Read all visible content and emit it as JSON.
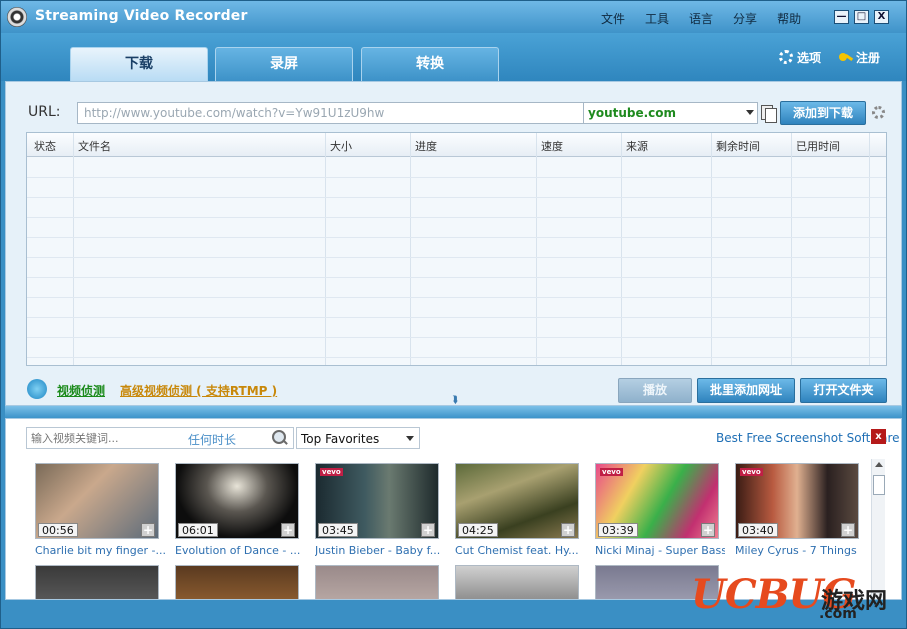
{
  "app": {
    "title": "Streaming Video Recorder"
  },
  "menu": [
    "文件",
    "工具",
    "语言",
    "分享",
    "帮助"
  ],
  "window_buttons": [
    "—",
    "□",
    "X"
  ],
  "tabs": [
    {
      "label": "下载",
      "active": true
    },
    {
      "label": "录屏",
      "active": false
    },
    {
      "label": "转换",
      "active": false
    }
  ],
  "header_actions": {
    "options": "选项",
    "register": "注册"
  },
  "url_bar": {
    "label": "URL:",
    "value": "http://www.youtube.com/watch?v=Yw91U1zU9hw",
    "site": "youtube.com",
    "add_button": "添加到下载"
  },
  "table": {
    "columns": [
      "状态",
      "文件名",
      "大小",
      "进度",
      "速度",
      "来源",
      "剩余时间",
      "已用时间"
    ],
    "rows": []
  },
  "detect": {
    "video_detect": "视频侦测",
    "advanced_detect": "高级视频侦测 ( 支持RTMP )"
  },
  "actions": {
    "play": "播放",
    "batch_add": "批里添加网址",
    "open_folder": "打开文件夹"
  },
  "browser": {
    "search_placeholder": "输入视频关键词...",
    "search_hint": "任何时长",
    "category": "Top Favorites",
    "ad_link": "Best Free Screenshot Software",
    "ad_close": "x"
  },
  "videos": [
    {
      "duration": "00:56",
      "title": "Charlie bit my finger -..."
    },
    {
      "duration": "06:01",
      "title": "Evolution of Dance - ..."
    },
    {
      "duration": "03:45",
      "title": "Justin Bieber - Baby f..."
    },
    {
      "duration": "04:25",
      "title": "Cut Chemist feat. Hy..."
    },
    {
      "duration": "03:39",
      "title": "Nicki Minaj - Super Bass"
    },
    {
      "duration": "03:40",
      "title": "Miley Cyrus - 7 Things"
    }
  ],
  "badges": {
    "vevo": "vevo"
  },
  "watermark": {
    "brand": "UCBUG",
    "game": "游戏网",
    "com": ".com"
  },
  "colors": {
    "accent": "#3a8fc4",
    "link_green": "#1a8a1a",
    "link_orange": "#c8880a"
  }
}
